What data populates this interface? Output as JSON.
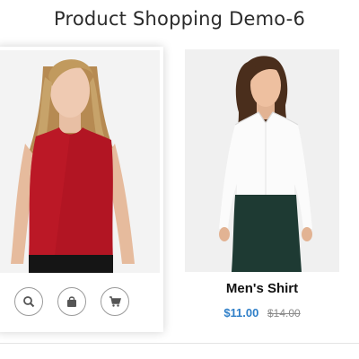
{
  "page": {
    "title": "Product Shopping Demo-6"
  },
  "products": [
    {
      "image": "woman in red sleeveless top",
      "actions": [
        "search-icon",
        "shopping-bag-icon",
        "cart-icon"
      ]
    },
    {
      "image": "woman in white shirt and dark skirt",
      "name": "Men's Shirt",
      "price": "$11.00",
      "old_price": "$14.00"
    }
  ],
  "colors": {
    "price": "#2f7fc8",
    "old_price": "#8a8a8a",
    "title": "#2b2b2b",
    "top_red": "#b21523",
    "skirt": "#1e3a33"
  }
}
